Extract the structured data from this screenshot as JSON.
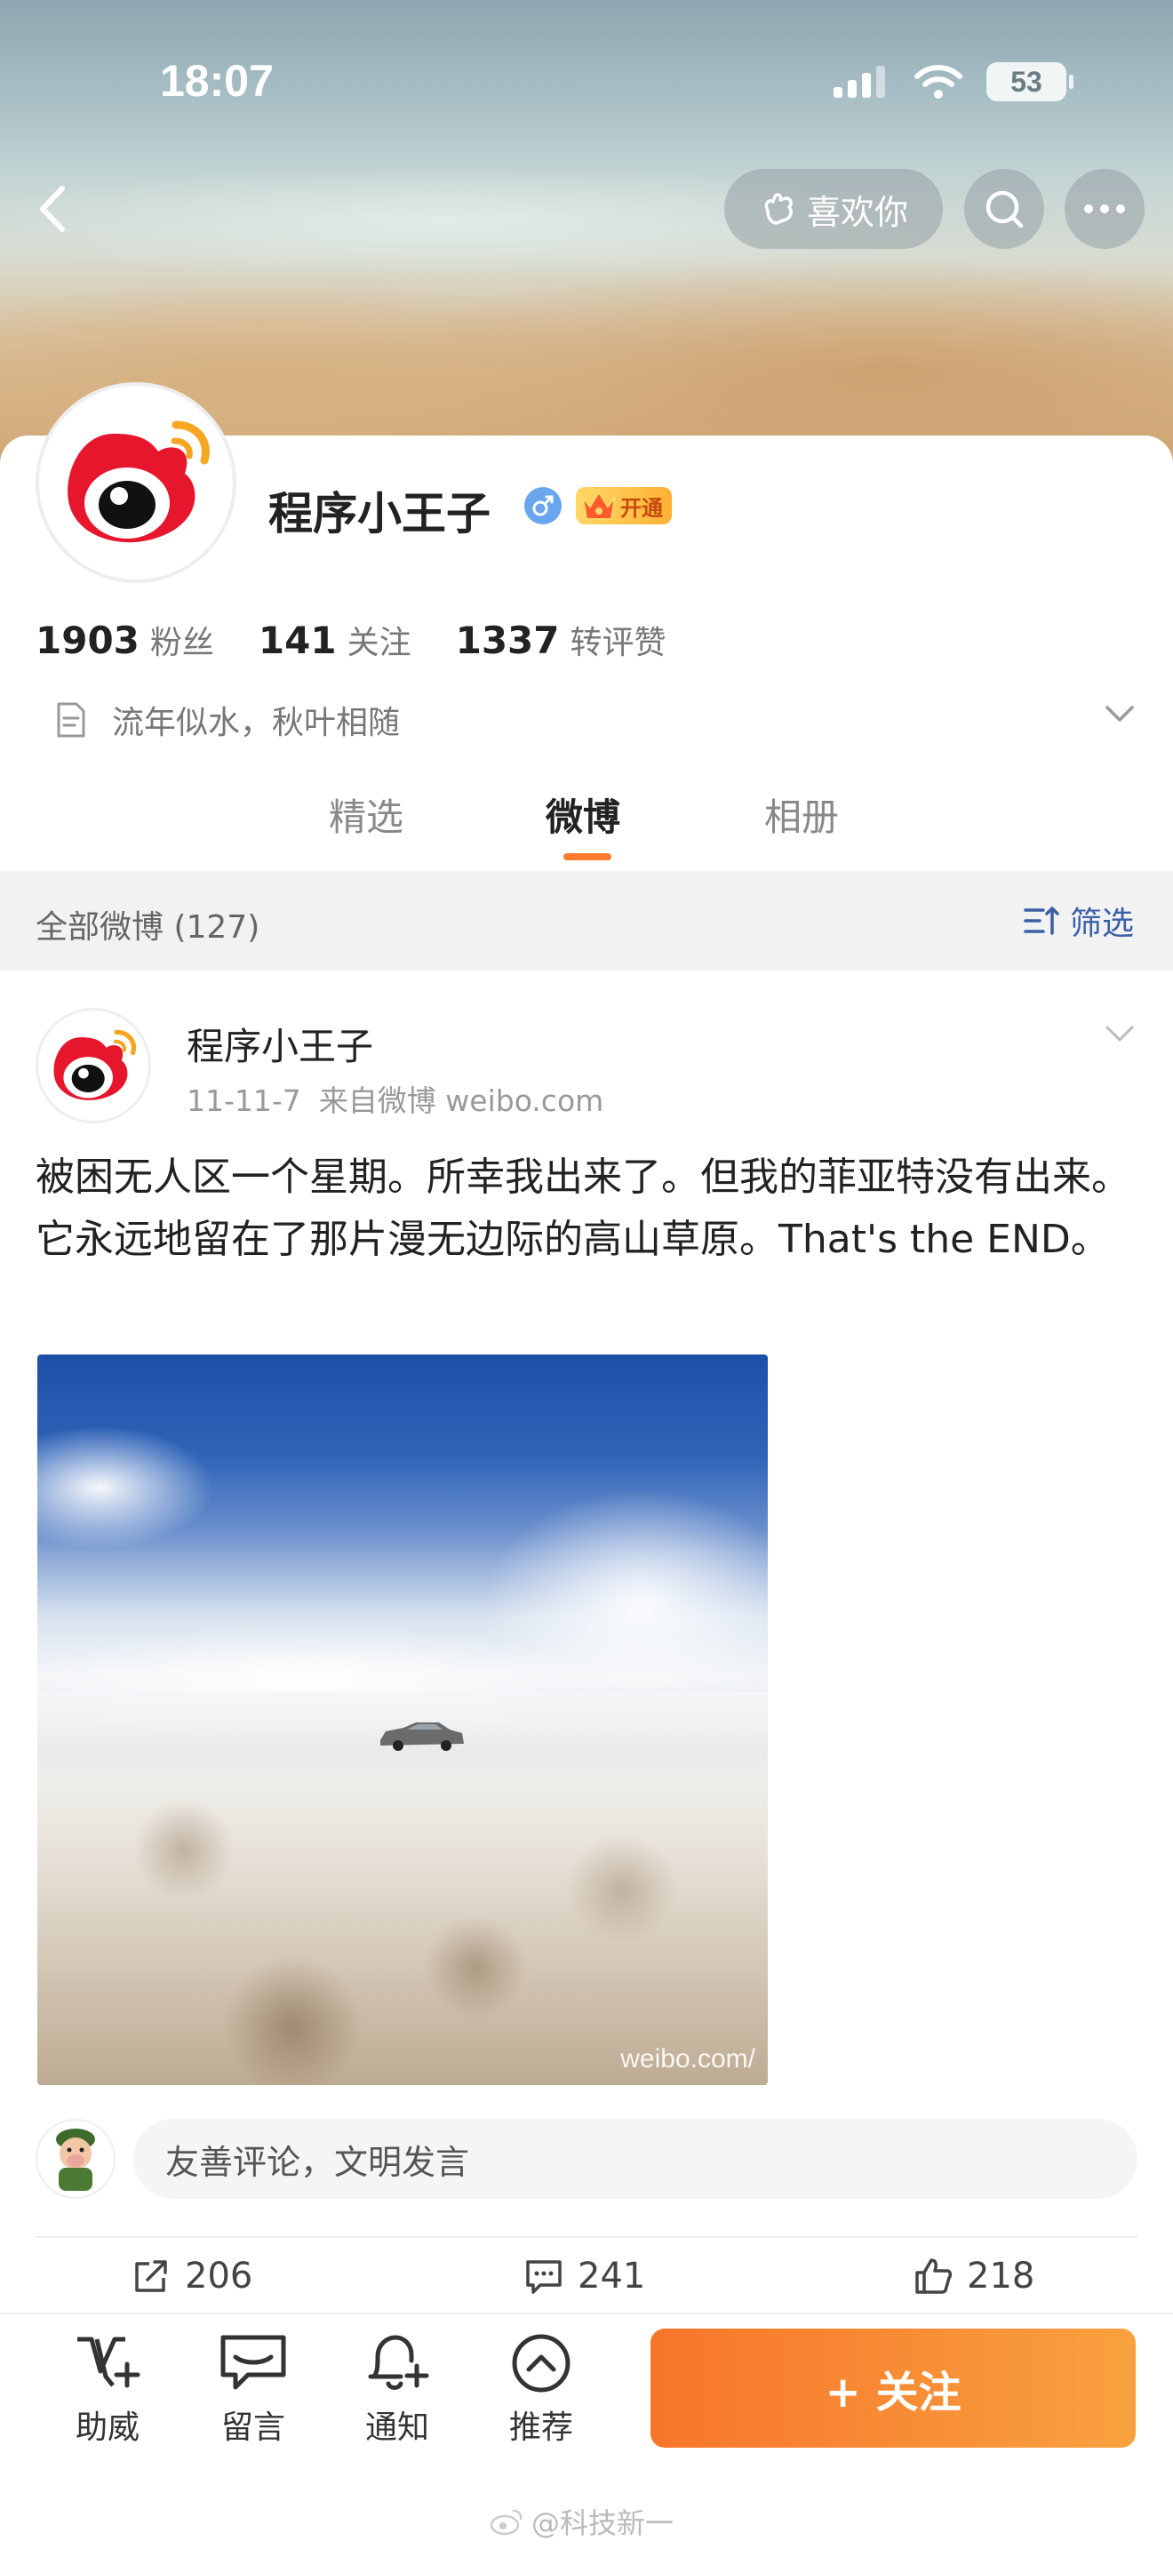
{
  "status_bar": {
    "time": "18:07",
    "battery": "53"
  },
  "header": {
    "like_label": "喜欢你"
  },
  "profile": {
    "name": "程序小王子",
    "vip_label": "开通",
    "stats": [
      {
        "num": "1903",
        "label": "粉丝"
      },
      {
        "num": "141",
        "label": "关注"
      },
      {
        "num": "1337",
        "label": "转评赞"
      }
    ],
    "bio": "流年似水，秋叶相随",
    "tabs": [
      "精选",
      "微博",
      "相册"
    ],
    "active_tab": "微博"
  },
  "filter": {
    "title": "全部微博 (127)",
    "button": "筛选"
  },
  "post": {
    "author": "程序小王子",
    "date": "11-11-7",
    "source": "来自微博 weibo.com",
    "text": "被困无人区一个星期。所幸我出来了。但我的菲亚特没有出来。它永远地留在了那片漫无边际的高山草原。That's the END。",
    "image_watermark": "weibo.com/",
    "comment_placeholder": "友善评论，文明发言",
    "actions": {
      "repost": "206",
      "comment": "241",
      "like": "218"
    }
  },
  "bottom_bar": {
    "items": [
      "助威",
      "留言",
      "通知",
      "推荐"
    ],
    "follow": "+ 关注",
    "watermark": "@科技新一"
  },
  "colors": {
    "accent": "#f7752b",
    "link": "#3a5fa6",
    "weibo_red": "#e6162d"
  }
}
